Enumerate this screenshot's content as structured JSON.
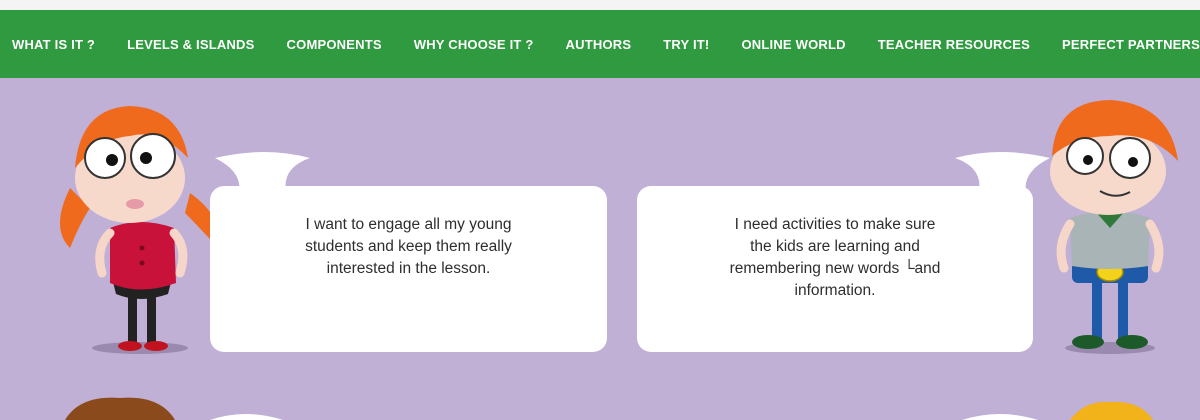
{
  "nav": {
    "items": [
      "WHAT IS IT ?",
      "LEVELS & ISLANDS",
      "COMPONENTS",
      "WHY CHOOSE IT ?",
      "AUTHORS",
      "TRY IT!",
      "ONLINE WORLD",
      "TEACHER RESOURCES",
      "PERFECT PARTNERS"
    ]
  },
  "quotes": {
    "left": "I want to engage all my young\nstudents and keep them really\ninterested in the lesson.",
    "right": "I need activities to make sure\nthe kids are learning and\nremembering new words  └and\ninformation."
  },
  "colors": {
    "nav_bg": "#2f9a3f",
    "page_bg": "#c0b0d6",
    "bubble": "#ffffff"
  }
}
